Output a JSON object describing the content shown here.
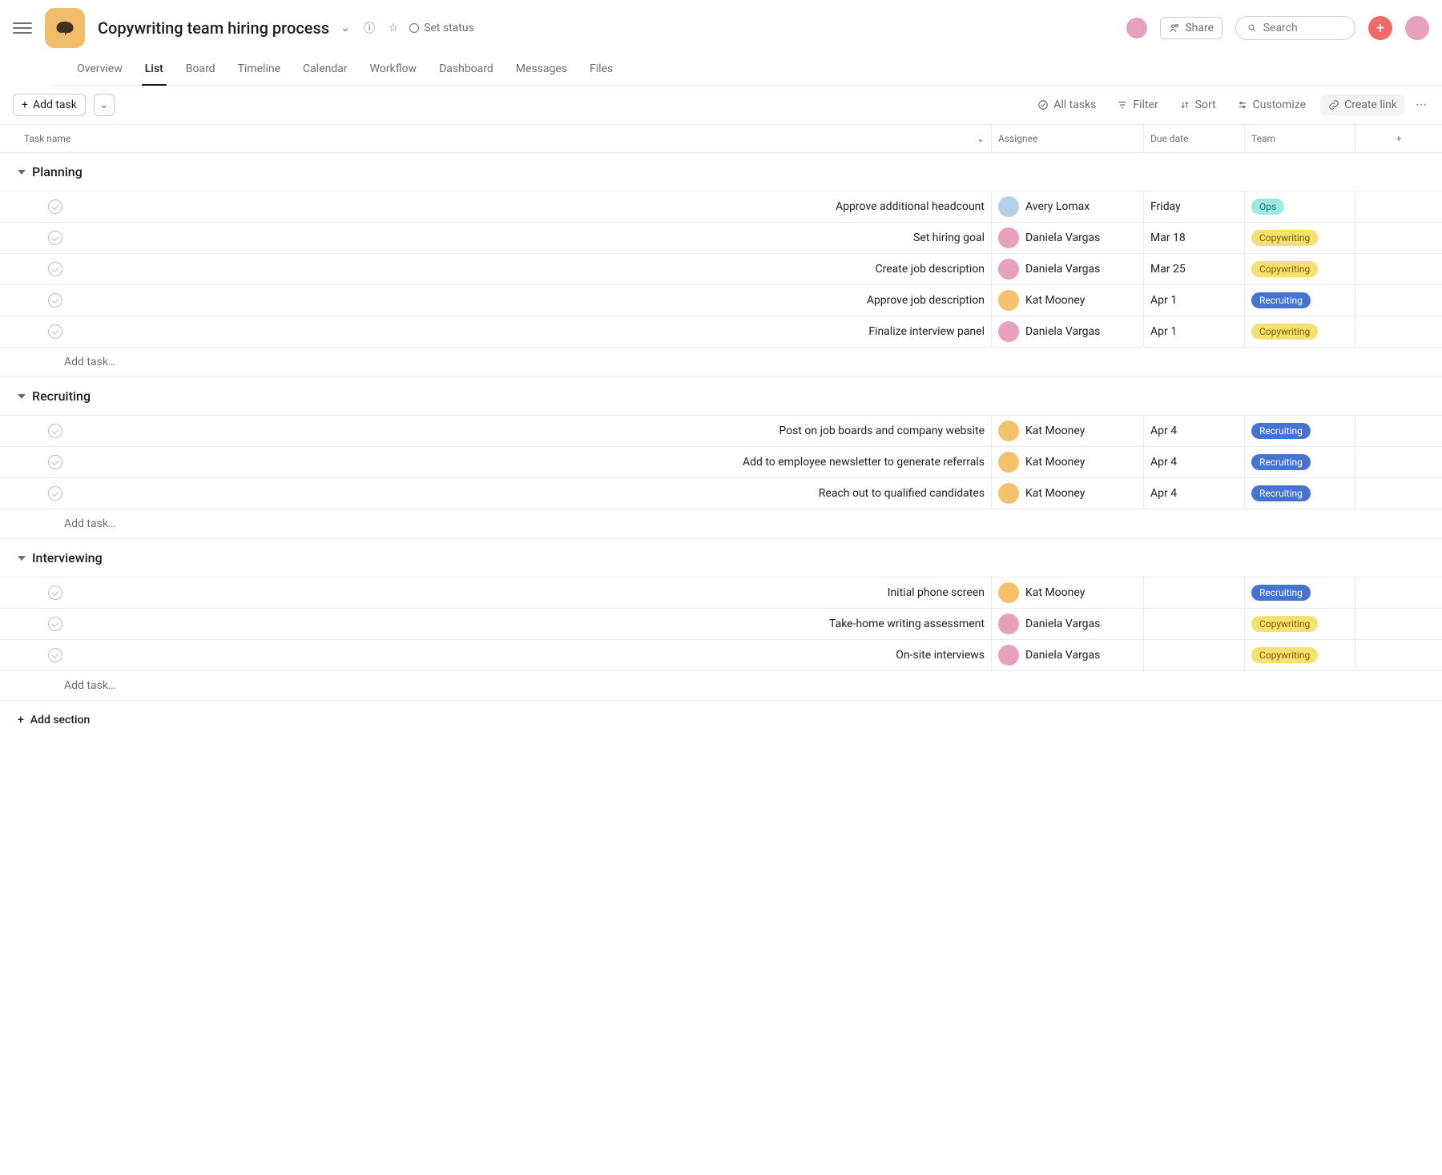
{
  "header": {
    "project_title": "Copywriting team hiring process",
    "status_label": "Set status",
    "share_label": "Share",
    "search_placeholder": "Search",
    "tabs": [
      "Overview",
      "List",
      "Board",
      "Timeline",
      "Calendar",
      "Workflow",
      "Dashboard",
      "Messages",
      "Files"
    ],
    "active_tab": 1
  },
  "toolbar": {
    "add_task": "Add task",
    "all_tasks": "All tasks",
    "filter": "Filter",
    "sort": "Sort",
    "customize": "Customize",
    "create_link": "Create link"
  },
  "columns": {
    "task_name": "Task name",
    "assignee": "Assignee",
    "due_date": "Due date",
    "team": "Team"
  },
  "teams": {
    "ops": "Ops",
    "copywriting": "Copywriting",
    "recruiting": "Recruiting"
  },
  "assignees": {
    "al": "Avery Lomax",
    "dv": "Daniela Vargas",
    "km": "Kat Mooney"
  },
  "sections": [
    {
      "title": "Planning",
      "tasks": [
        {
          "name": "Approve additional headcount",
          "assignee": "al",
          "due": "Friday",
          "team": "ops"
        },
        {
          "name": "Set hiring goal",
          "assignee": "dv",
          "due": "Mar 18",
          "team": "copywriting"
        },
        {
          "name": "Create job description",
          "assignee": "dv",
          "due": "Mar 25",
          "team": "copywriting"
        },
        {
          "name": "Approve job description",
          "assignee": "km",
          "due": "Apr 1",
          "team": "recruiting"
        },
        {
          "name": "Finalize interview panel",
          "assignee": "dv",
          "due": "Apr 1",
          "team": "copywriting"
        }
      ]
    },
    {
      "title": "Recruiting",
      "tasks": [
        {
          "name": "Post on job boards and company website",
          "assignee": "km",
          "due": "Apr 4",
          "team": "recruiting"
        },
        {
          "name": "Add to employee newsletter to generate referrals",
          "assignee": "km",
          "due": "Apr 4",
          "team": "recruiting"
        },
        {
          "name": "Reach out to qualified candidates",
          "assignee": "km",
          "due": "Apr 4",
          "team": "recruiting"
        }
      ]
    },
    {
      "title": "Interviewing",
      "tasks": [
        {
          "name": "Initial phone screen",
          "assignee": "km",
          "due": "",
          "team": "recruiting"
        },
        {
          "name": "Take-home writing assessment",
          "assignee": "dv",
          "due": "",
          "team": "copywriting"
        },
        {
          "name": "On-site interviews",
          "assignee": "dv",
          "due": "",
          "team": "copywriting"
        }
      ]
    }
  ],
  "add_task_row": "Add task…",
  "add_section": "Add section"
}
